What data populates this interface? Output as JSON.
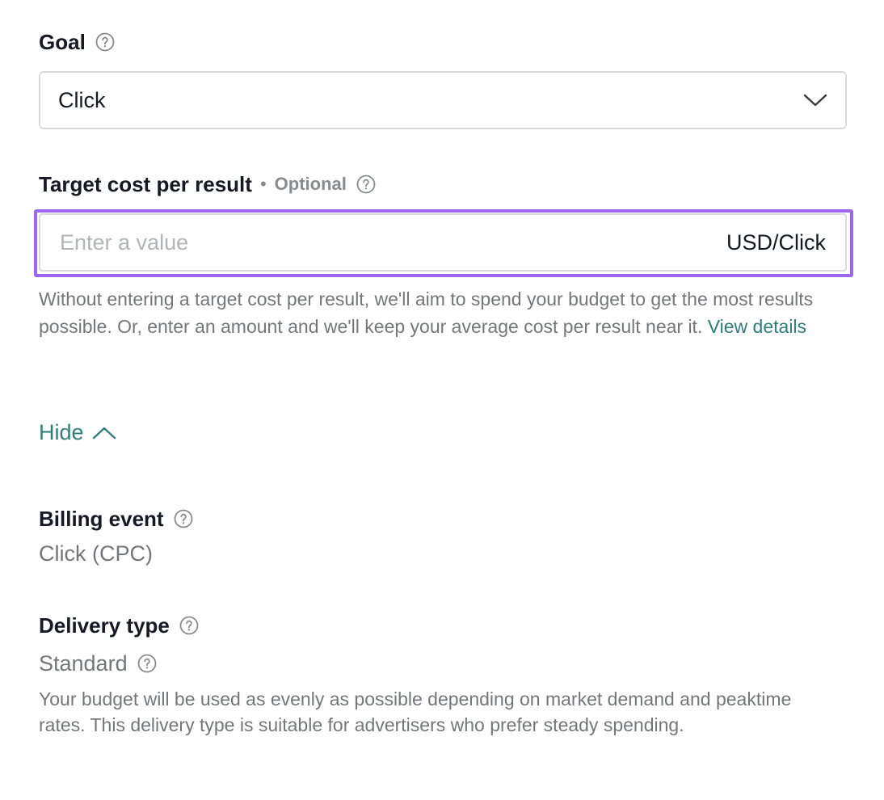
{
  "goal": {
    "label": "Goal",
    "help_icon": "question-circle-icon",
    "selected": "Click",
    "dropdown_icon": "chevron-down-icon"
  },
  "target_cost": {
    "label": "Target cost per result",
    "separator": "•",
    "optional": "Optional",
    "help_icon": "question-circle-icon",
    "placeholder": "Enter a value",
    "value": "",
    "unit": "USD/Click",
    "help_text": "Without entering a target cost per result, we'll aim to spend your budget to get the most results possible. Or, enter an amount and we'll keep your average cost per result near it.",
    "link_label": "View details",
    "focus_color": "#9a68f0"
  },
  "toggle": {
    "label": "Hide",
    "icon": "chevron-up-icon"
  },
  "billing_event": {
    "label": "Billing event",
    "help_icon": "question-circle-icon",
    "value": "Click (CPC)"
  },
  "delivery_type": {
    "label": "Delivery type",
    "help_icon": "question-circle-icon",
    "value": "Standard",
    "value_help_icon": "question-circle-icon",
    "description": "Your budget will be used as evenly as possible depending on market demand and peaktime rates. This delivery type is suitable for advertisers who prefer steady spending."
  },
  "colors": {
    "text_primary": "#161823",
    "text_secondary": "#75767c",
    "link": "#2d7f7a",
    "border": "#d9d9dc"
  }
}
